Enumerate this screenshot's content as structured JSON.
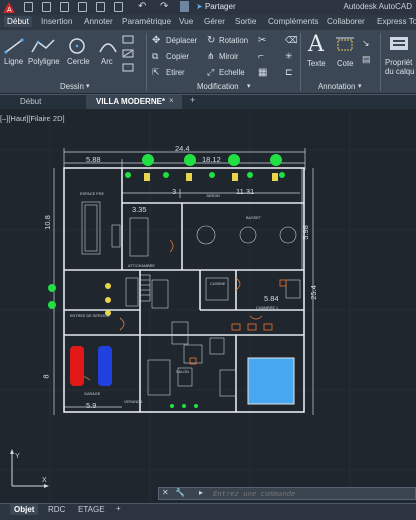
{
  "app": {
    "title": "Autodesk AutoCAD",
    "share_label": "Partager",
    "logo_letter": "A"
  },
  "ribbon": {
    "tabs": [
      "Début",
      "Insertion",
      "Annoter",
      "Paramétrique",
      "Vue",
      "Gérer",
      "Sortie",
      "Compléments",
      "Collaborer",
      "Express Too"
    ],
    "draw": {
      "line": "Ligne",
      "polyline": "Polyligne",
      "circle": "Cercle",
      "arc": "Arc",
      "panel": "Dessin"
    },
    "modify": {
      "move": "Déplacer",
      "rotate": "Rotation",
      "copy": "Copier",
      "mirror": "Miroir",
      "stretch": "Etirer",
      "scale": "Echelle",
      "panel": "Modification"
    },
    "annotation": {
      "text": "Texte",
      "dimension": "Cote",
      "panel": "Annotation"
    },
    "properties": {
      "label1": "Propriét",
      "label2": "du calqu"
    }
  },
  "doc_tabs": {
    "start": "Début",
    "active": "VILLA MODERNE*"
  },
  "viewport": {
    "label": "[–][Haut][Filaire 2D]",
    "dims": {
      "top_total": "24.4",
      "top_left": "5.88",
      "top_mid": "18.12",
      "seg_3": "3",
      "seg_1131": "11.31",
      "seg_335": "3.35",
      "left_108": "10.8",
      "left_8": "8",
      "bottom_59": "5.9",
      "right_598": "5.98",
      "right_254": "25.4",
      "inner_584": "5.84"
    },
    "rooms": [
      "ESPACE PRE",
      "JARDIN",
      "BASSET",
      "ATT/CHAMBRE",
      "CUISINE",
      "CHAMBRE 1",
      "ENTREE DE SERVICE",
      "SALON",
      "GARAGE",
      "VERANDA"
    ]
  },
  "command": {
    "placeholder": "Entrez une commande"
  },
  "layout_tabs": {
    "model": "Objet",
    "rdc": "RDC",
    "etage": "ETAGE",
    "add": "+"
  },
  "colors": {
    "accent": "#1f8fd8",
    "bg": "#1f262e",
    "wall": "#dfe5ea",
    "plant": "#1ee63a",
    "pool": "#47a8f0"
  }
}
